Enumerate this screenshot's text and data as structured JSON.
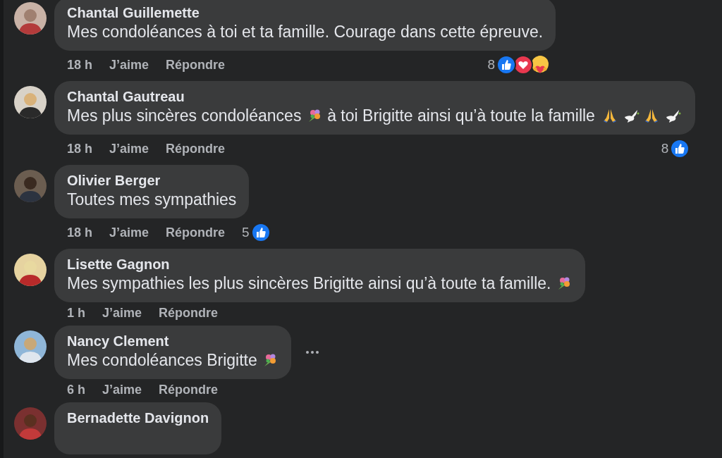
{
  "comments": [
    {
      "author": "Chantal Guillemette",
      "segments": [
        {
          "kind": "text",
          "value": "Mes condoléances à toi et ta famille. Courage dans cette épreuve."
        }
      ],
      "time": "18 h",
      "like": "J’aime",
      "reply": "Répondre",
      "reactions": {
        "count": "8",
        "icons": [
          {
            "kind": "like"
          },
          {
            "kind": "love"
          },
          {
            "kind": "care"
          }
        ]
      }
    },
    {
      "author": "Chantal Gautreau",
      "segments": [
        {
          "kind": "text",
          "value": "Mes plus sincères condoléances "
        },
        {
          "kind": "bouquet"
        },
        {
          "kind": "text",
          "value": " à toi Brigitte ainsi qu’à toute la famille "
        },
        {
          "kind": "pray"
        },
        {
          "kind": "dove"
        },
        {
          "kind": "pray"
        },
        {
          "kind": "dove"
        }
      ],
      "time": "18 h",
      "like": "J’aime",
      "reply": "Répondre",
      "reactions": {
        "count": "8",
        "icons": [
          {
            "kind": "like"
          }
        ]
      }
    },
    {
      "author": "Olivier Berger",
      "segments": [
        {
          "kind": "text",
          "value": "Toutes mes sympathies"
        }
      ],
      "time": "18 h",
      "like": "J’aime",
      "reply": "Répondre",
      "reactions": {
        "count": "5",
        "icons": [
          {
            "kind": "like"
          }
        ]
      }
    },
    {
      "author": "Lisette Gagnon",
      "segments": [
        {
          "kind": "text",
          "value": "Mes sympathies les plus sincères Brigitte ainsi qu’à toute ta famille. "
        },
        {
          "kind": "bouquet"
        }
      ],
      "time": "1 h",
      "like": "J’aime",
      "reply": "Répondre"
    },
    {
      "author": "Nancy Clement",
      "segments": [
        {
          "kind": "text",
          "value": "Mes condoléances Brigitte "
        },
        {
          "kind": "bouquet"
        }
      ],
      "time": "6 h",
      "like": "J’aime",
      "reply": "Répondre",
      "more_button": true
    },
    {
      "author": "Bernadette Davignon"
    }
  ]
}
